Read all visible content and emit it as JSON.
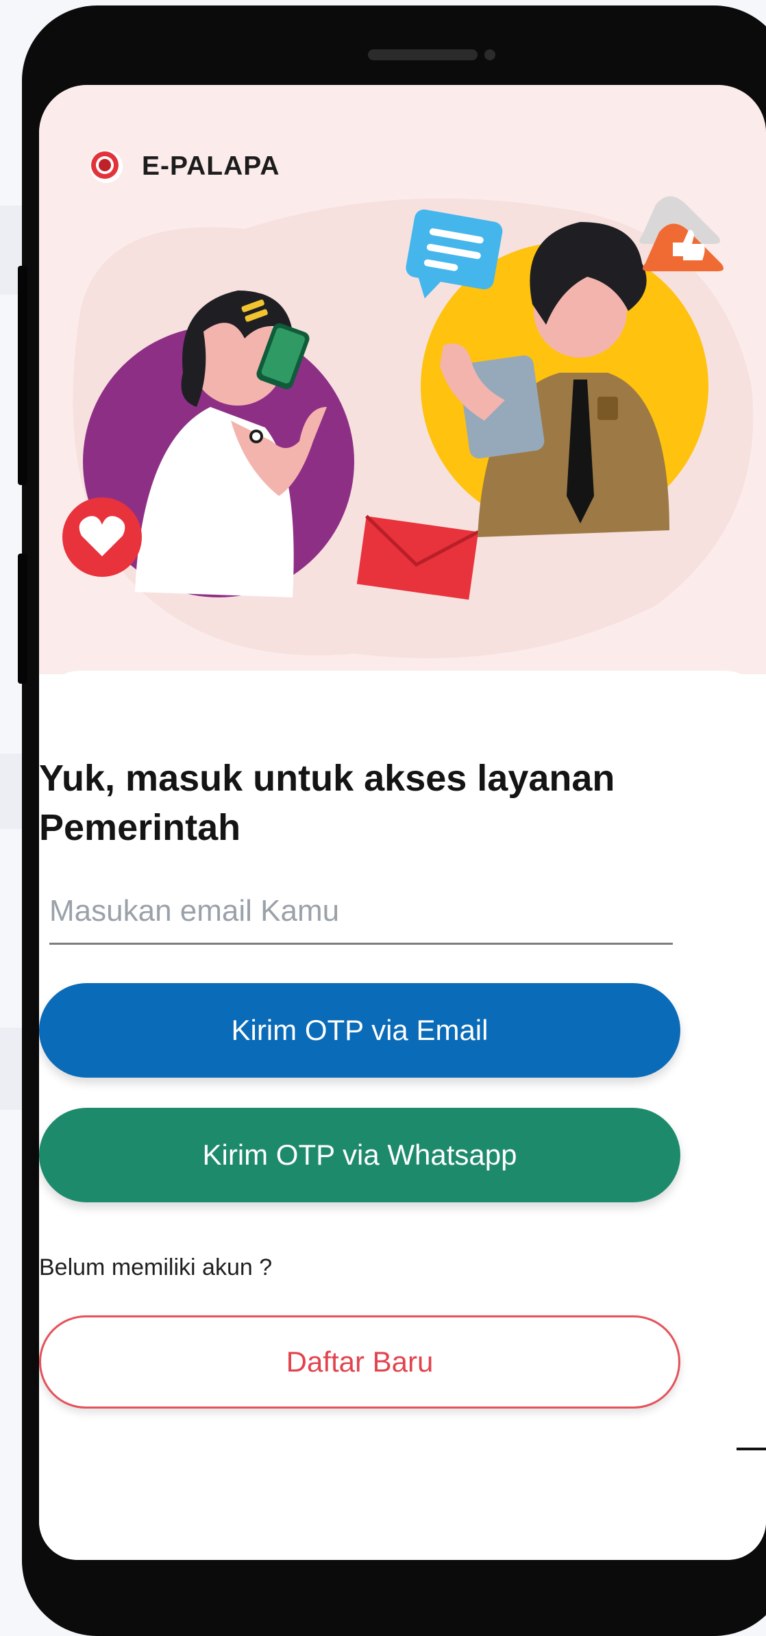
{
  "app": {
    "name": "E-PALAPA"
  },
  "login": {
    "heading": "Yuk, masuk untuk akses layanan Pemerintah",
    "email_placeholder": "Masukan email Kamu",
    "email_value": "",
    "send_otp_email_label": "Kirim OTP via Email",
    "send_otp_whatsapp_label": "Kirim OTP via Whatsapp",
    "no_account_prompt": "Belum memiliki akun ?",
    "register_label": "Daftar Baru"
  },
  "colors": {
    "hero_background": "#fbeceb",
    "primary_blue": "#0a6bb8",
    "whatsapp_green": "#1e8a6c",
    "register_red": "#e2444d",
    "phone_frame": "#0b0b0b"
  },
  "icons": {
    "brand": "garuda-logo-icon",
    "chat": "chat-bubble-icon",
    "like": "thumbs-up-icon",
    "heart": "heart-icon",
    "mail": "envelope-icon"
  }
}
